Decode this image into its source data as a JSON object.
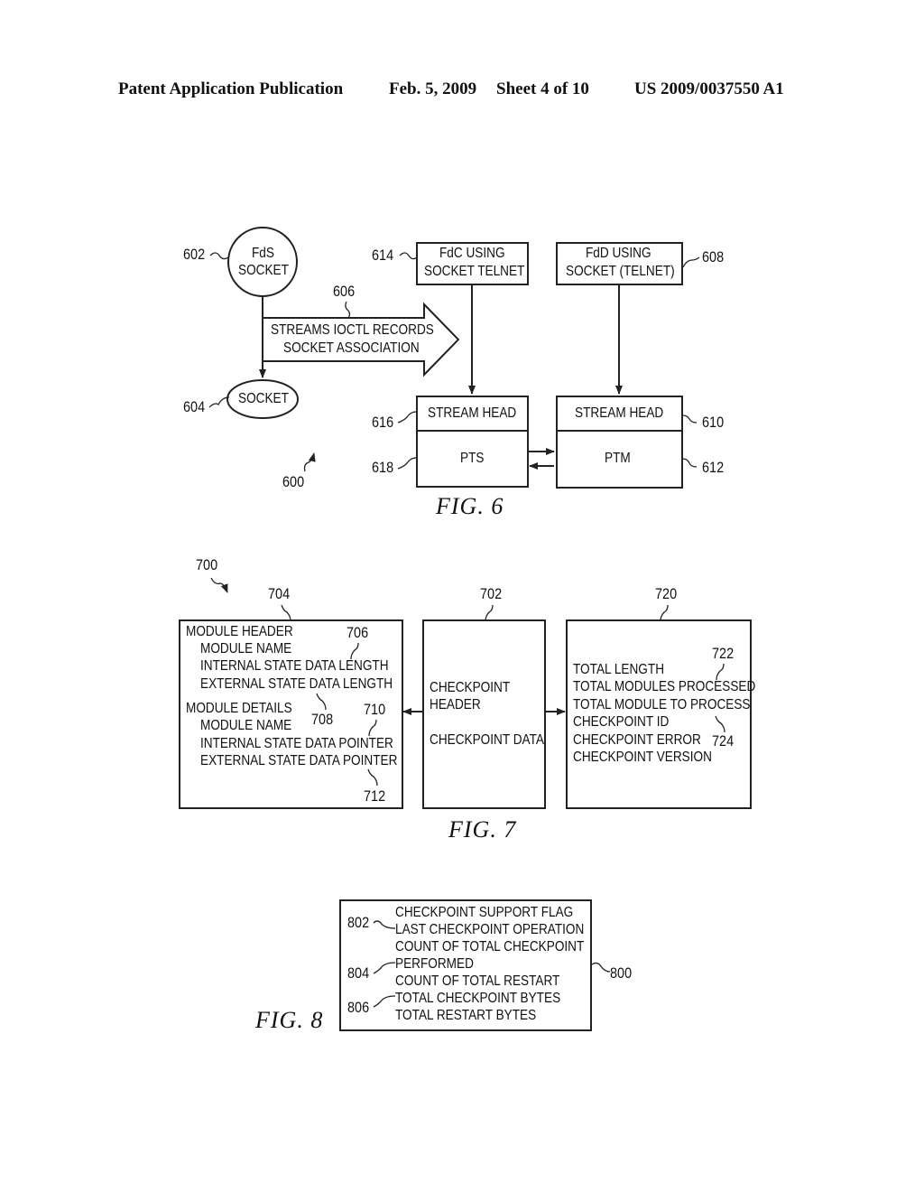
{
  "header": {
    "publication": "Patent Application Publication",
    "date": "Feb. 5, 2009",
    "sheet": "Sheet 4 of 10",
    "number": "US 2009/0037550 A1"
  },
  "fig6": {
    "caption": "FIG. 6",
    "ref_diagram": "600",
    "fds_socket": {
      "ref": "602",
      "line1": "FdS",
      "line2": "SOCKET"
    },
    "socket": {
      "ref": "604",
      "label": "SOCKET"
    },
    "arrow": {
      "ref": "606",
      "line1": "STREAMS IOCTL RECORDS",
      "line2": "SOCKET ASSOCIATION"
    },
    "fdc": {
      "ref": "614",
      "line1": "FdC USING",
      "line2": "SOCKET TELNET"
    },
    "fdd": {
      "ref": "608",
      "line1": "FdD USING",
      "line2": "SOCKET (TELNET)"
    },
    "left_stack": {
      "head_ref": "616",
      "head": "STREAM HEAD",
      "body_ref": "618",
      "body": "PTS"
    },
    "right_stack": {
      "head_ref": "610",
      "head": "STREAM HEAD",
      "body_ref": "612",
      "body": "PTM"
    }
  },
  "fig7": {
    "caption": "FIG. 7",
    "ref_diagram": "700",
    "module_box": {
      "ref": "704",
      "lines": [
        "MODULE HEADER",
        "MODULE NAME",
        "INTERNAL STATE DATA LENGTH",
        "EXTERNAL STATE DATA LENGTH",
        "MODULE DETAILS",
        "MODULE NAME",
        "INTERNAL STATE DATA POINTER",
        "EXTERNAL STATE DATA POINTER"
      ],
      "callouts": [
        "706",
        "708",
        "710",
        "712"
      ]
    },
    "checkpoint_box": {
      "ref": "702",
      "line1": "CHECKPOINT",
      "line2": "HEADER",
      "line3": "CHECKPOINT DATA"
    },
    "header_box": {
      "ref": "720",
      "lines": [
        "TOTAL LENGTH",
        "TOTAL MODULES PROCESSED",
        "TOTAL MODULE TO PROCESS",
        "CHECKPOINT ID",
        "CHECKPOINT ERROR",
        "CHECKPOINT VERSION"
      ],
      "callouts": [
        "722",
        "724"
      ]
    }
  },
  "fig8": {
    "caption": "FIG. 8",
    "ref_box": "800",
    "lines": [
      "CHECKPOINT SUPPORT FLAG",
      "LAST CHECKPOINT OPERATION",
      "COUNT OF TOTAL CHECKPOINT",
      "PERFORMED",
      "COUNT OF TOTAL RESTART",
      "TOTAL CHECKPOINT BYTES",
      "TOTAL RESTART BYTES"
    ],
    "callouts": [
      "802",
      "804",
      "806"
    ]
  }
}
